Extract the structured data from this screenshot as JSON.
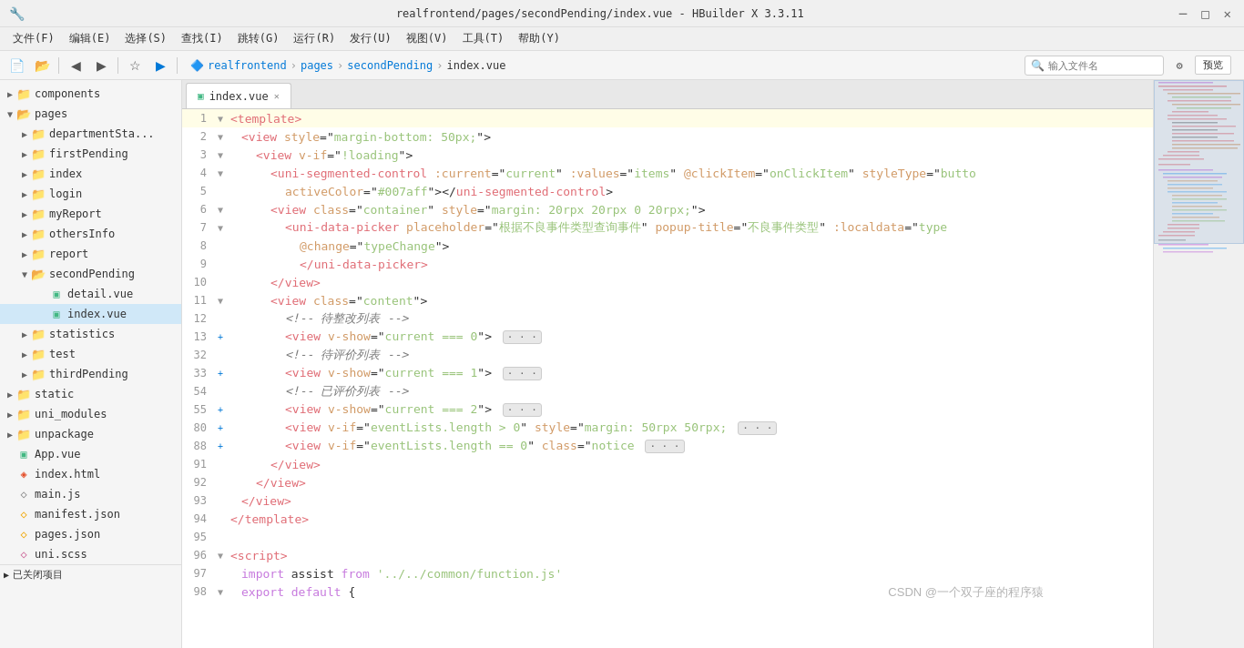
{
  "titleBar": {
    "title": "realfrontend/pages/secondPending/index.vue - HBuilder X 3.3.11",
    "minimize": "─",
    "maximize": "□",
    "close": "✕"
  },
  "menuBar": {
    "items": [
      "文件(F)",
      "编辑(E)",
      "选择(S)",
      "查找(I)",
      "跳转(G)",
      "运行(R)",
      "发行(U)",
      "视图(V)",
      "工具(T)",
      "帮助(Y)"
    ]
  },
  "toolbar": {
    "breadcrumb": [
      "realfrontend",
      "pages",
      "secondPending",
      "index.vue"
    ],
    "searchPlaceholder": "输入文件名",
    "previewLabel": "预览"
  },
  "sidebar": {
    "tree": [
      {
        "id": "components",
        "label": "components",
        "type": "folder",
        "level": 0,
        "collapsed": true
      },
      {
        "id": "pages",
        "label": "pages",
        "type": "folder",
        "level": 0,
        "collapsed": false
      },
      {
        "id": "departmentSta",
        "label": "departmentSta...",
        "type": "folder",
        "level": 1,
        "collapsed": true
      },
      {
        "id": "firstPending",
        "label": "firstPending",
        "type": "folder",
        "level": 1,
        "collapsed": true
      },
      {
        "id": "index-folder",
        "label": "index",
        "type": "folder",
        "level": 1,
        "collapsed": true
      },
      {
        "id": "login",
        "label": "login",
        "type": "folder",
        "level": 1,
        "collapsed": true
      },
      {
        "id": "myReport",
        "label": "myReport",
        "type": "folder",
        "level": 1,
        "collapsed": true
      },
      {
        "id": "othersInfo",
        "label": "othersInfo",
        "type": "folder",
        "level": 1,
        "collapsed": true
      },
      {
        "id": "report",
        "label": "report",
        "type": "folder",
        "level": 1,
        "collapsed": true
      },
      {
        "id": "secondPending",
        "label": "secondPending",
        "type": "folder",
        "level": 1,
        "collapsed": false
      },
      {
        "id": "detail-vue",
        "label": "detail.vue",
        "type": "file-vue",
        "level": 2
      },
      {
        "id": "index-vue",
        "label": "index.vue",
        "type": "file-vue",
        "level": 2,
        "active": true
      },
      {
        "id": "statistics",
        "label": "statistics",
        "type": "folder",
        "level": 1,
        "collapsed": true
      },
      {
        "id": "test",
        "label": "test",
        "type": "folder",
        "level": 1,
        "collapsed": true
      },
      {
        "id": "thirdPending",
        "label": "thirdPending",
        "type": "folder",
        "level": 1,
        "collapsed": true
      },
      {
        "id": "static",
        "label": "static",
        "type": "folder",
        "level": 0,
        "collapsed": true
      },
      {
        "id": "uni_modules",
        "label": "uni_modules",
        "type": "folder",
        "level": 0,
        "collapsed": true
      },
      {
        "id": "unpackage",
        "label": "unpackage",
        "type": "folder",
        "level": 0,
        "collapsed": true
      },
      {
        "id": "App-vue",
        "label": "App.vue",
        "type": "file-vue",
        "level": 0
      },
      {
        "id": "index-html",
        "label": "index.html",
        "type": "file-html",
        "level": 0
      },
      {
        "id": "main-js",
        "label": "main.js",
        "type": "file-js",
        "level": 0
      },
      {
        "id": "manifest-json",
        "label": "manifest.json",
        "type": "file-json",
        "level": 0
      },
      {
        "id": "pages-json",
        "label": "pages.json",
        "type": "file-json",
        "level": 0
      },
      {
        "id": "uni-scss",
        "label": "uni.scss",
        "type": "file-scss",
        "level": 0
      }
    ],
    "closedSection": "已关闭项目"
  },
  "tabs": [
    {
      "id": "index-vue-tab",
      "label": "index.vue",
      "active": true
    }
  ],
  "editor": {
    "filename": "index.vue",
    "lines": [
      {
        "num": 1,
        "fold": "▼",
        "indent": 0,
        "content": "<template>",
        "type": "tag"
      },
      {
        "num": 2,
        "fold": "▼",
        "indent": 1,
        "content": "<view style=\"margin-bottom: 50px;\">",
        "type": "tag"
      },
      {
        "num": 3,
        "fold": "▼",
        "indent": 2,
        "content": "<view v-if=\"!loading\">",
        "type": "tag"
      },
      {
        "num": 4,
        "fold": "▼",
        "indent": 3,
        "content": "<uni-segmented-control :current=\"current\" :values=\"items\" @clickItem=\"onClickItem\" styleType=\"butto",
        "type": "mixed"
      },
      {
        "num": 5,
        "fold": " ",
        "indent": 4,
        "content": "activeColor=\"#007aff\"></uni-segmented-control>",
        "type": "mixed"
      },
      {
        "num": 6,
        "fold": "▼",
        "indent": 3,
        "content": "<view class=\"container\" style=\"margin: 20rpx 20rpx 0 20rpx;\">",
        "type": "tag"
      },
      {
        "num": 7,
        "fold": "▼",
        "indent": 4,
        "content": "<uni-data-picker placeholder=\"根据不良事件类型查询事件\" popup-title=\"不良事件类型\" :localdata=\"type",
        "type": "mixed"
      },
      {
        "num": 8,
        "fold": " ",
        "indent": 5,
        "content": "@change=\"typeChange\">",
        "type": "mixed"
      },
      {
        "num": 9,
        "fold": " ",
        "indent": 5,
        "content": "</uni-data-picker>",
        "type": "tag"
      },
      {
        "num": 10,
        "fold": " ",
        "indent": 3,
        "content": "</view>",
        "type": "tag"
      },
      {
        "num": 11,
        "fold": "▼",
        "indent": 3,
        "content": "<view class=\"content\">",
        "type": "tag"
      },
      {
        "num": 12,
        "fold": " ",
        "indent": 4,
        "content": "<!-- 待整改列表 -->",
        "type": "comment"
      },
      {
        "num": 13,
        "fold": "+",
        "indent": 4,
        "content": "<view v-show=\"current === 0\">",
        "type": "tag",
        "collapsed": true
      },
      {
        "num": 32,
        "fold": " ",
        "indent": 4,
        "content": "<!-- 待评价列表 -->",
        "type": "comment"
      },
      {
        "num": 33,
        "fold": "+",
        "indent": 4,
        "content": "<view v-show=\"current === 1\">",
        "type": "tag",
        "collapsed": true
      },
      {
        "num": 54,
        "fold": " ",
        "indent": 4,
        "content": "<!-- 已评价列表 -->",
        "type": "comment"
      },
      {
        "num": 55,
        "fold": "+",
        "indent": 4,
        "content": "<view v-show=\"current === 2\">",
        "type": "tag",
        "collapsed": true
      },
      {
        "num": 80,
        "fold": "+",
        "indent": 4,
        "content": "<view v-if=\"eventLists.length > 0\" style=\"margin: 50rpx 50rpx;\">",
        "type": "tag",
        "collapsed": true
      },
      {
        "num": 88,
        "fold": "+",
        "indent": 4,
        "content": "<view v-if=\"eventLists.length == 0\" class=\"notice\">",
        "type": "tag",
        "collapsed": true
      },
      {
        "num": 91,
        "fold": " ",
        "indent": 3,
        "content": "</view>",
        "type": "tag"
      },
      {
        "num": 92,
        "fold": " ",
        "indent": 2,
        "content": "</view>",
        "type": "tag"
      },
      {
        "num": 93,
        "fold": " ",
        "indent": 1,
        "content": "</view>",
        "type": "tag"
      },
      {
        "num": 94,
        "fold": " ",
        "indent": 0,
        "content": "</template>",
        "type": "tag"
      },
      {
        "num": 95,
        "fold": " ",
        "indent": 0,
        "content": "",
        "type": "plain"
      },
      {
        "num": 96,
        "fold": "▼",
        "indent": 0,
        "content": "<script>",
        "type": "tag"
      },
      {
        "num": 97,
        "fold": " ",
        "indent": 1,
        "content": "import assist from '../../common/function.js'",
        "type": "plain"
      },
      {
        "num": 98,
        "fold": "▼",
        "indent": 1,
        "content": "export default {",
        "type": "plain"
      }
    ]
  },
  "watermark": "CSDN @一个双子座的程序猿",
  "statusBar": {
    "closedProjects": "已关闭项目"
  }
}
